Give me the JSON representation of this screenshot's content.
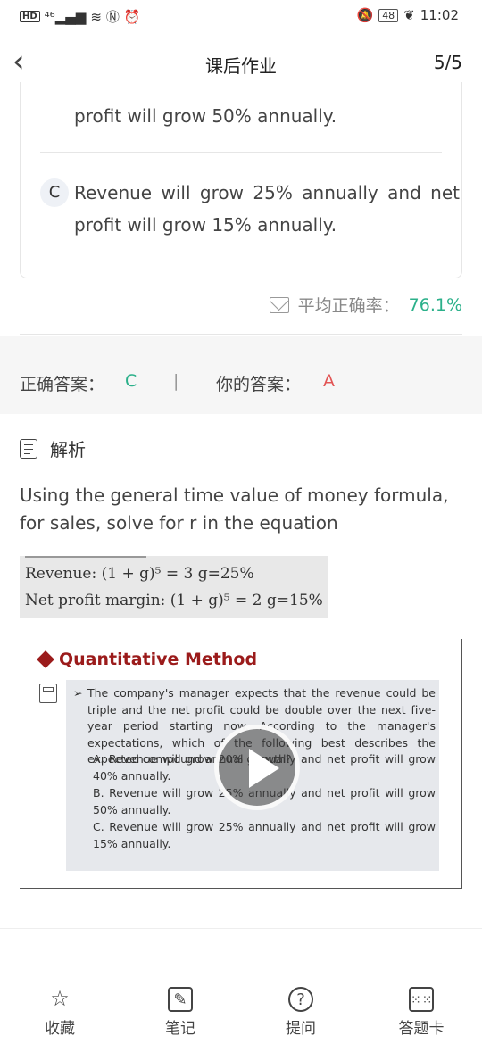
{
  "status_bar": {
    "left": "HD ⁴⁶ᴳ",
    "battery": "48",
    "time": "11:02"
  },
  "header": {
    "title": "课后作业",
    "pager": "5/5"
  },
  "options": {
    "b_tail": "profit will grow 50% annually.",
    "c_badge": "C",
    "c_text": "Revenue will grow 25% annually and net profit will grow 15% annually."
  },
  "accuracy": {
    "label": "平均正确率：",
    "value": "76.1%"
  },
  "answer": {
    "correct_label": "正确答案：",
    "correct_value": "C",
    "separator": "|",
    "yours_label": "你的答案：",
    "yours_value": "A"
  },
  "analysis": {
    "heading": "解析",
    "text": "Using the general time value of money formula, for sales, solve for r in the equation",
    "formula_line1": "Revenue: (1 + g)⁵ = 3    g=25%",
    "formula_line2": "Net profit margin: (1 + g)⁵ = 2    g=15%"
  },
  "slide": {
    "title": "Quantitative Method",
    "arrow": "➢",
    "question": "The company's manager expects that the revenue could be triple and the net profit could be double over the next five-year period starting now. According to the manager's expectations, which of the following best describes the expected compound annual growth?",
    "options": [
      "A. Revenue will grow 20% annually and net profit will grow 40% annually.",
      "B. Revenue will grow 25% annually and net profit will grow 50% annually.",
      "C. Revenue will grow 25% annually and net profit will grow 15% annually."
    ]
  },
  "nav": [
    {
      "label": "收藏",
      "icon": "star-icon"
    },
    {
      "label": "笔记",
      "icon": "note-icon"
    },
    {
      "label": "提问",
      "icon": "question-icon"
    },
    {
      "label": "答题卡",
      "icon": "answer-card-icon"
    }
  ]
}
